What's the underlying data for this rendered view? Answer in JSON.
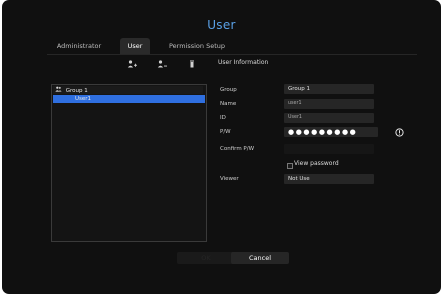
{
  "window": {
    "title": "User"
  },
  "tabs": [
    {
      "label": "Administrator",
      "active": false
    },
    {
      "label": "User",
      "active": true
    },
    {
      "label": "Permission Setup",
      "active": false
    }
  ],
  "toolbar": {
    "icons": [
      "add-group-icon",
      "add-user-icon",
      "delete-icon"
    ]
  },
  "tree": {
    "group": {
      "label": "Group 1",
      "icon": "group-icon"
    },
    "user": {
      "label": "User1",
      "selected": true
    }
  },
  "info": {
    "section_title": "User Information",
    "group_label": "Group",
    "group_value": "Group 1",
    "name_label": "Name",
    "name_value": "user1",
    "id_label": "ID",
    "id_value": "User1",
    "pw_label": "P/W",
    "pw_value": "●●●●●●●●●",
    "confirm_label": "Confirm P/W",
    "view_password_label": "View password",
    "viewer_label": "Viewer",
    "viewer_value": "Not Use"
  },
  "buttons": {
    "ok_label": "OK",
    "cancel_label": "Cancel"
  },
  "colors": {
    "background": "#101010",
    "accent": "#5aa0e6",
    "selection": "#2f6fe0",
    "field": "#262626"
  }
}
